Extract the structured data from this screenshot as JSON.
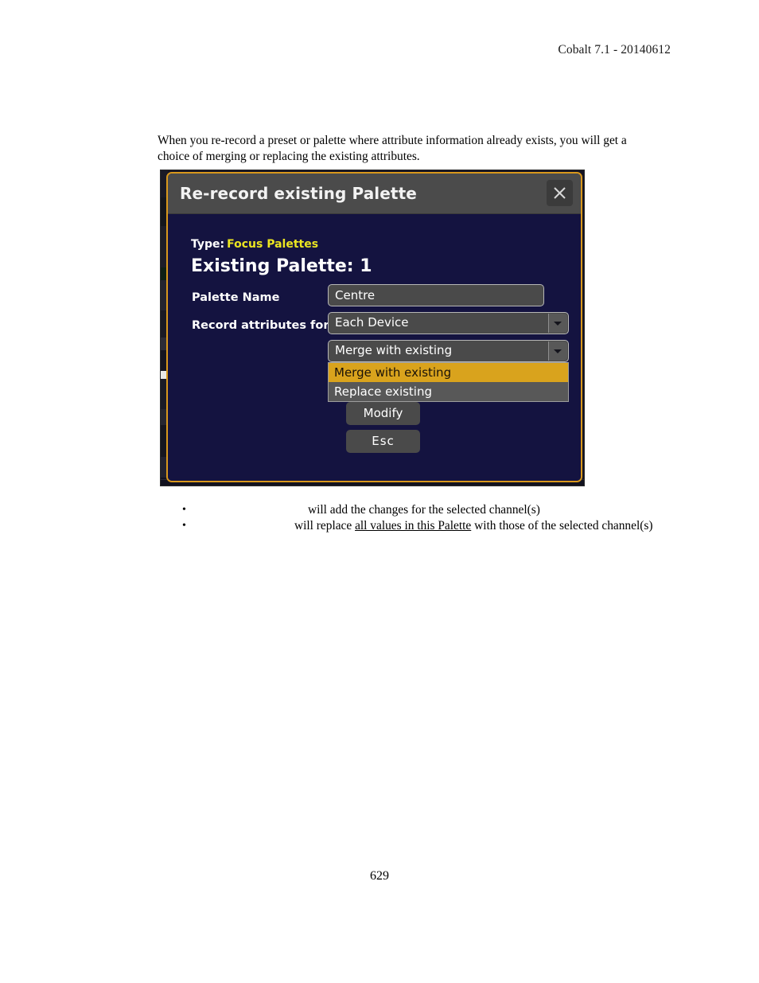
{
  "document": {
    "header": "Cobalt 7.1 - 20140612",
    "page_number": "629",
    "intro_paragraph": "When you re-record a preset or palette where attribute information already exists, you will get a choice of merging or replacing the existing attributes."
  },
  "dialog": {
    "title": "Re-record existing Palette",
    "close_icon": "close-icon",
    "type_label": "Type:",
    "type_value": "Focus Palettes",
    "existing_palette": "Existing Palette: 1",
    "fields": {
      "palette_name_label": "Palette Name",
      "palette_name_value": "Centre",
      "palette_name_placeholder": "Palette Name",
      "record_attributes_label": "Record attributes for",
      "record_attributes_value": "Each Device",
      "merge_mode_value": "Merge with existing"
    },
    "dropdown": {
      "open": true,
      "options": [
        {
          "label": "Merge with existing",
          "selected": true
        },
        {
          "label": "Replace existing",
          "selected": false
        }
      ]
    },
    "buttons": {
      "modify": "Modify",
      "esc": "Esc"
    },
    "colors": {
      "window_border": "#d9981c",
      "window_background": "#141340",
      "titlebar": "#4b4b4b",
      "accent_highlight": "#d9a31d",
      "type_value_text": "#ebe521",
      "control_fill": "#4a4a4a",
      "control_border": "#b7b7b7"
    }
  },
  "bullets": [
    {
      "marker": "•",
      "text_before": "will add the changes for the selected channel(s)",
      "underlined": "",
      "text_after": ""
    },
    {
      "marker": "•",
      "text_before": "will replace ",
      "underlined": "all values in this Palette",
      "text_after": " with those of the selected channel(s)"
    }
  ]
}
